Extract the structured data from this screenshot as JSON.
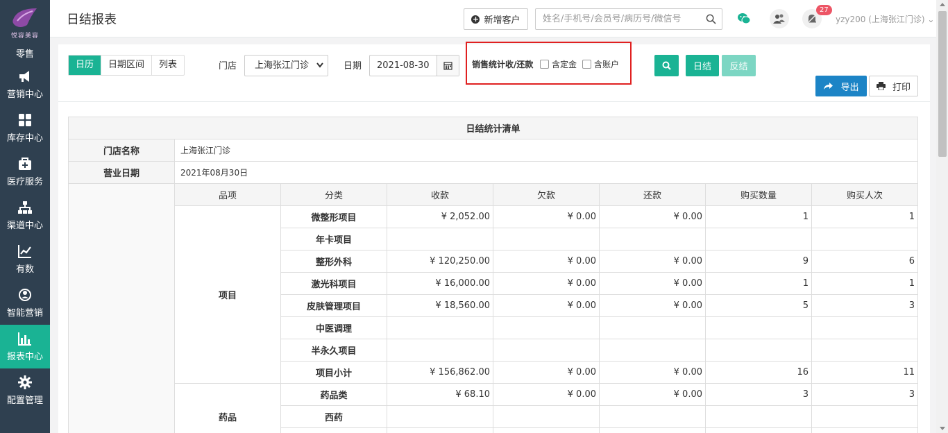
{
  "sidebar": {
    "logo_text": "悦容美容",
    "top_label": "零售",
    "items": [
      {
        "label": "营销中心",
        "icon": "megaphone-icon"
      },
      {
        "label": "库存中心",
        "icon": "grid-icon"
      },
      {
        "label": "医疗服务",
        "icon": "medkit-icon"
      },
      {
        "label": "渠道中心",
        "icon": "sitemap-icon"
      },
      {
        "label": "有数",
        "icon": "line-chart-icon"
      },
      {
        "label": "智能营销",
        "icon": "brain-icon"
      },
      {
        "label": "报表中心",
        "icon": "bar-chart-icon"
      },
      {
        "label": "配置管理",
        "icon": "gear-icon"
      }
    ],
    "active_index": 6
  },
  "header": {
    "title": "日结报表",
    "new_customer": "新增客户",
    "search_placeholder": "姓名/手机号/会员号/病历号/微信号",
    "notification_count": "27",
    "user": "yzy200 (上海张江门诊)"
  },
  "toolbar": {
    "view_tabs": [
      "日历",
      "日期区间",
      "列表"
    ],
    "active_view": 0,
    "store_label": "门店",
    "store_value": "上海张江门诊",
    "date_label": "日期",
    "date_value": "2021-08-30",
    "stats_label": "销售统计收/还款",
    "checkbox_deposit": "含定金",
    "checkbox_account": "含账户",
    "settle_button": "日结",
    "unsettle_button": "反结",
    "export_button": "导出",
    "print_button": "打印"
  },
  "report": {
    "caption": "日结统计清单",
    "store_key": "门店名称",
    "store_value": "上海张江门诊",
    "date_key": "营业日期",
    "date_value": "2021年08月30日",
    "columns": [
      "品项",
      "分类",
      "收款",
      "欠款",
      "还款",
      "购买数量",
      "购买人次"
    ],
    "groups": [
      {
        "name": "项目",
        "rows": [
          {
            "cls": "微整形项目",
            "recv": "¥ 2,052.00",
            "owe": "¥ 0.00",
            "repay": "¥ 0.00",
            "qty": "1",
            "times": "1"
          },
          {
            "cls": "年卡项目",
            "recv": "",
            "owe": "",
            "repay": "",
            "qty": "",
            "times": ""
          },
          {
            "cls": "整形外科",
            "recv": "¥ 120,250.00",
            "owe": "¥ 0.00",
            "repay": "¥ 0.00",
            "qty": "9",
            "times": "6"
          },
          {
            "cls": "激光科项目",
            "recv": "¥ 16,000.00",
            "owe": "¥ 0.00",
            "repay": "¥ 0.00",
            "qty": "1",
            "times": "1"
          },
          {
            "cls": "皮肤管理项目",
            "recv": "¥ 18,560.00",
            "owe": "¥ 0.00",
            "repay": "¥ 0.00",
            "qty": "5",
            "times": "3"
          },
          {
            "cls": "中医调理",
            "recv": "",
            "owe": "",
            "repay": "",
            "qty": "",
            "times": ""
          },
          {
            "cls": "半永久项目",
            "recv": "",
            "owe": "",
            "repay": "",
            "qty": "",
            "times": ""
          },
          {
            "cls": "项目小计",
            "recv": "¥ 156,862.00",
            "owe": "¥ 0.00",
            "repay": "¥ 0.00",
            "qty": "16",
            "times": "11"
          }
        ]
      },
      {
        "name": "药品",
        "rows": [
          {
            "cls": "药品类",
            "recv": "¥ 68.10",
            "owe": "¥ 0.00",
            "repay": "¥ 0.00",
            "qty": "3",
            "times": "3"
          },
          {
            "cls": "西药",
            "recv": "",
            "owe": "",
            "repay": "",
            "qty": "",
            "times": ""
          },
          {
            "cls": "",
            "recv": "",
            "owe": "",
            "repay": "",
            "qty": "",
            "times": ""
          }
        ]
      }
    ]
  },
  "colors": {
    "sidebar_bg": "#2f4050",
    "accent": "#1ab394",
    "blue": "#1c84c6",
    "highlight_border": "#e02020"
  }
}
